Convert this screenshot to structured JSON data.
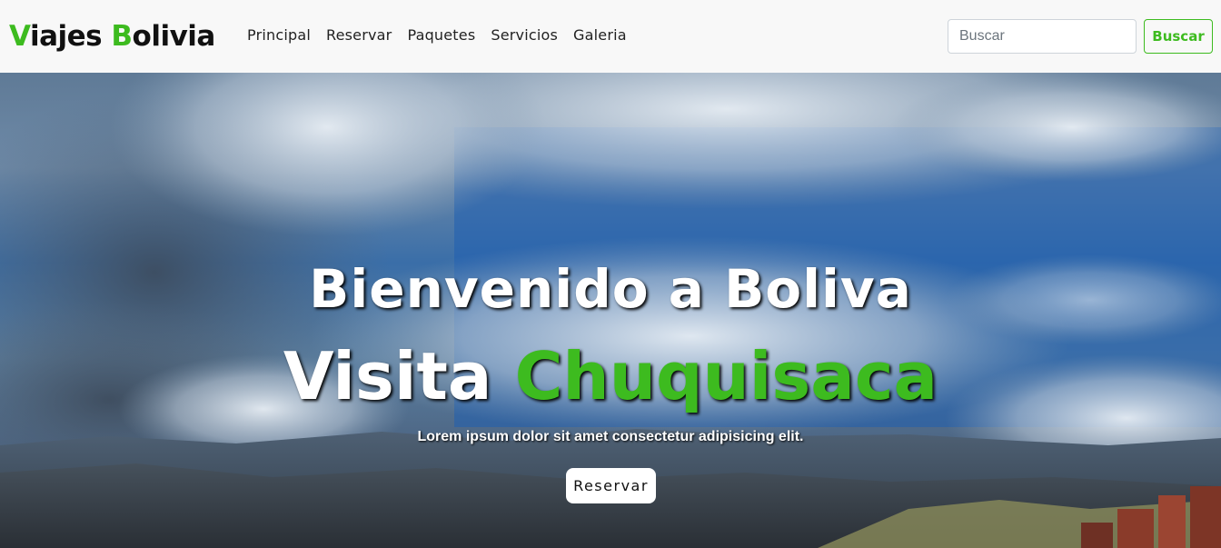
{
  "brand": {
    "first_initial": "V",
    "first_rest": "iajes ",
    "second_initial": "B",
    "second_rest": "olivia"
  },
  "nav": {
    "items": [
      {
        "label": "Principal"
      },
      {
        "label": "Reservar"
      },
      {
        "label": "Paquetes"
      },
      {
        "label": "Servicios"
      },
      {
        "label": "Galeria"
      }
    ]
  },
  "search": {
    "placeholder": "Buscar",
    "value": "",
    "button_label": "Buscar"
  },
  "hero": {
    "heading": "Bienvenido a Boliva",
    "subheading_white": "Visita ",
    "subheading_green": "Chuquisaca",
    "text": "Lorem ipsum dolor sit amet consectetur adipisicing elit.",
    "button_label": "Reservar"
  },
  "colors": {
    "accent": "#3dbb1f",
    "navbar_bg": "#f8f8f8",
    "text_dark": "#111111"
  },
  "background": {
    "image_description_icon": "mountain-city-sky-image"
  }
}
